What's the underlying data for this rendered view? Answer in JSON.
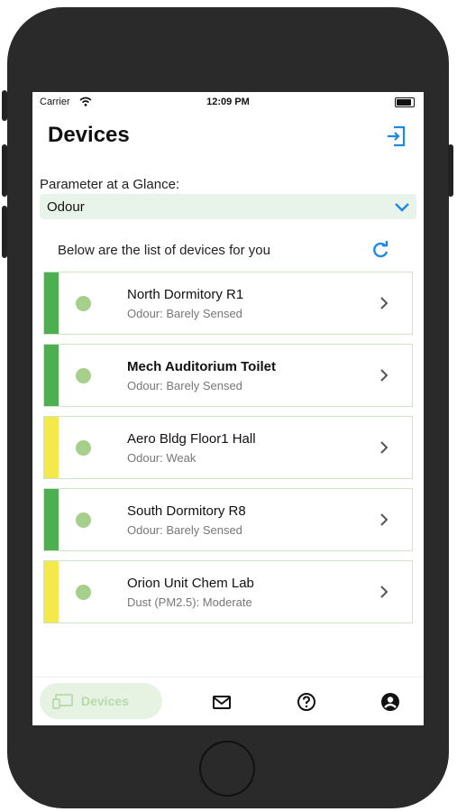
{
  "status_bar": {
    "carrier": "Carrier",
    "time": "12:09 PM"
  },
  "header": {
    "title": "Devices"
  },
  "parameter": {
    "label": "Parameter at a Glance:",
    "selected": "Odour"
  },
  "list": {
    "caption": "Below are the list of devices for you",
    "devices": [
      {
        "name": "North Dormitory R1",
        "status": "Odour: Barely Sensed",
        "bar_color": "#4caf50"
      },
      {
        "name": "Mech Auditorium Toilet",
        "status": "Odour: Barely Sensed",
        "bar_color": "#4caf50"
      },
      {
        "name": "Aero Bldg Floor1 Hall",
        "status": "Odour: Weak",
        "bar_color": "#f5e84a"
      },
      {
        "name": "South Dormitory R8",
        "status": "Odour: Barely Sensed",
        "bar_color": "#4caf50"
      },
      {
        "name": "Orion Unit Chem Lab",
        "status": "Dust (PM2.5): Moderate",
        "bar_color": "#f5e84a"
      }
    ]
  },
  "tabbar": {
    "devices_label": "Devices"
  },
  "colors": {
    "accent": "#1e88e5",
    "active_tab_bg": "#e6f3e3",
    "select_bg": "#e8f4ea"
  }
}
